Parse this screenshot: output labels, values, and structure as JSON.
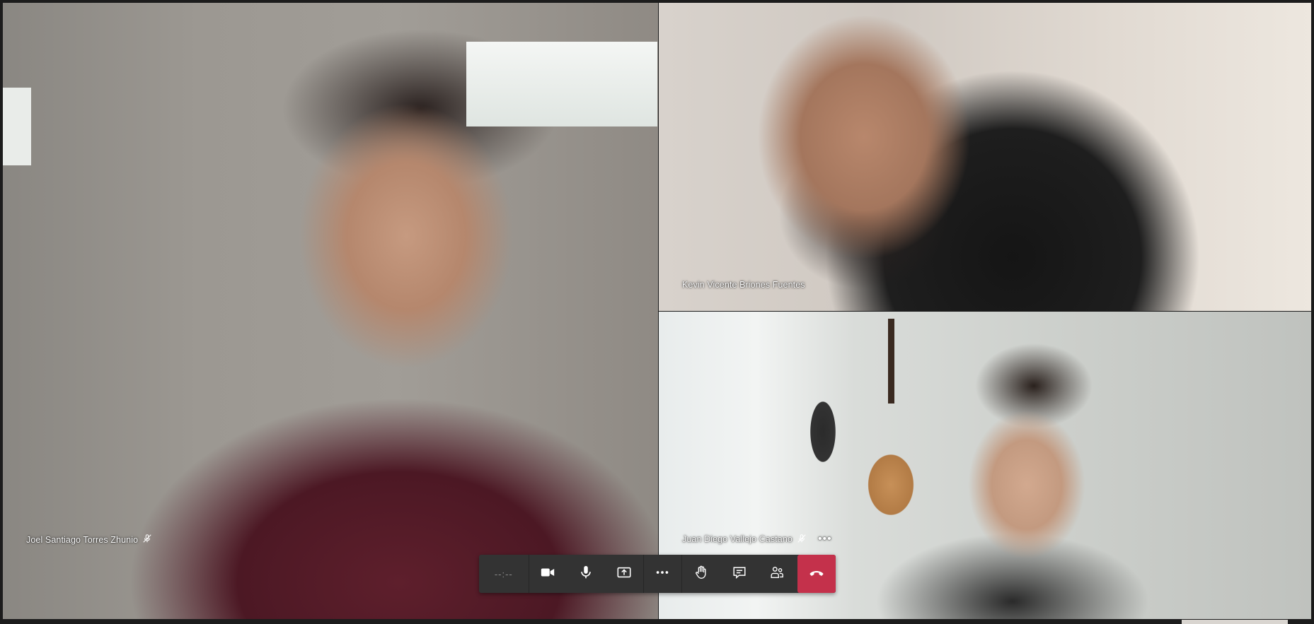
{
  "participants": {
    "joel": {
      "name": "Joel Santiago Torres Zhunio",
      "muted": true
    },
    "kevin": {
      "name": "Kevin Vicente Briones Fuentes",
      "muted": false
    },
    "juan": {
      "name": "Juan Diego Vallejo Castano",
      "muted": true,
      "more_label": "•••"
    }
  },
  "toolbar": {
    "timer": "--:--",
    "buttons": [
      {
        "id": "camera",
        "icon": "video-camera-icon"
      },
      {
        "id": "mic",
        "icon": "microphone-icon"
      },
      {
        "id": "share",
        "icon": "share-screen-icon"
      },
      {
        "id": "more",
        "icon": "more-options-icon"
      },
      {
        "id": "raise-hand",
        "icon": "raise-hand-icon"
      },
      {
        "id": "chat",
        "icon": "chat-icon"
      },
      {
        "id": "participants",
        "icon": "participants-icon"
      },
      {
        "id": "hangup",
        "icon": "hang-up-icon"
      }
    ],
    "hangup_color": "#c4314b",
    "background_color": "#333333"
  }
}
